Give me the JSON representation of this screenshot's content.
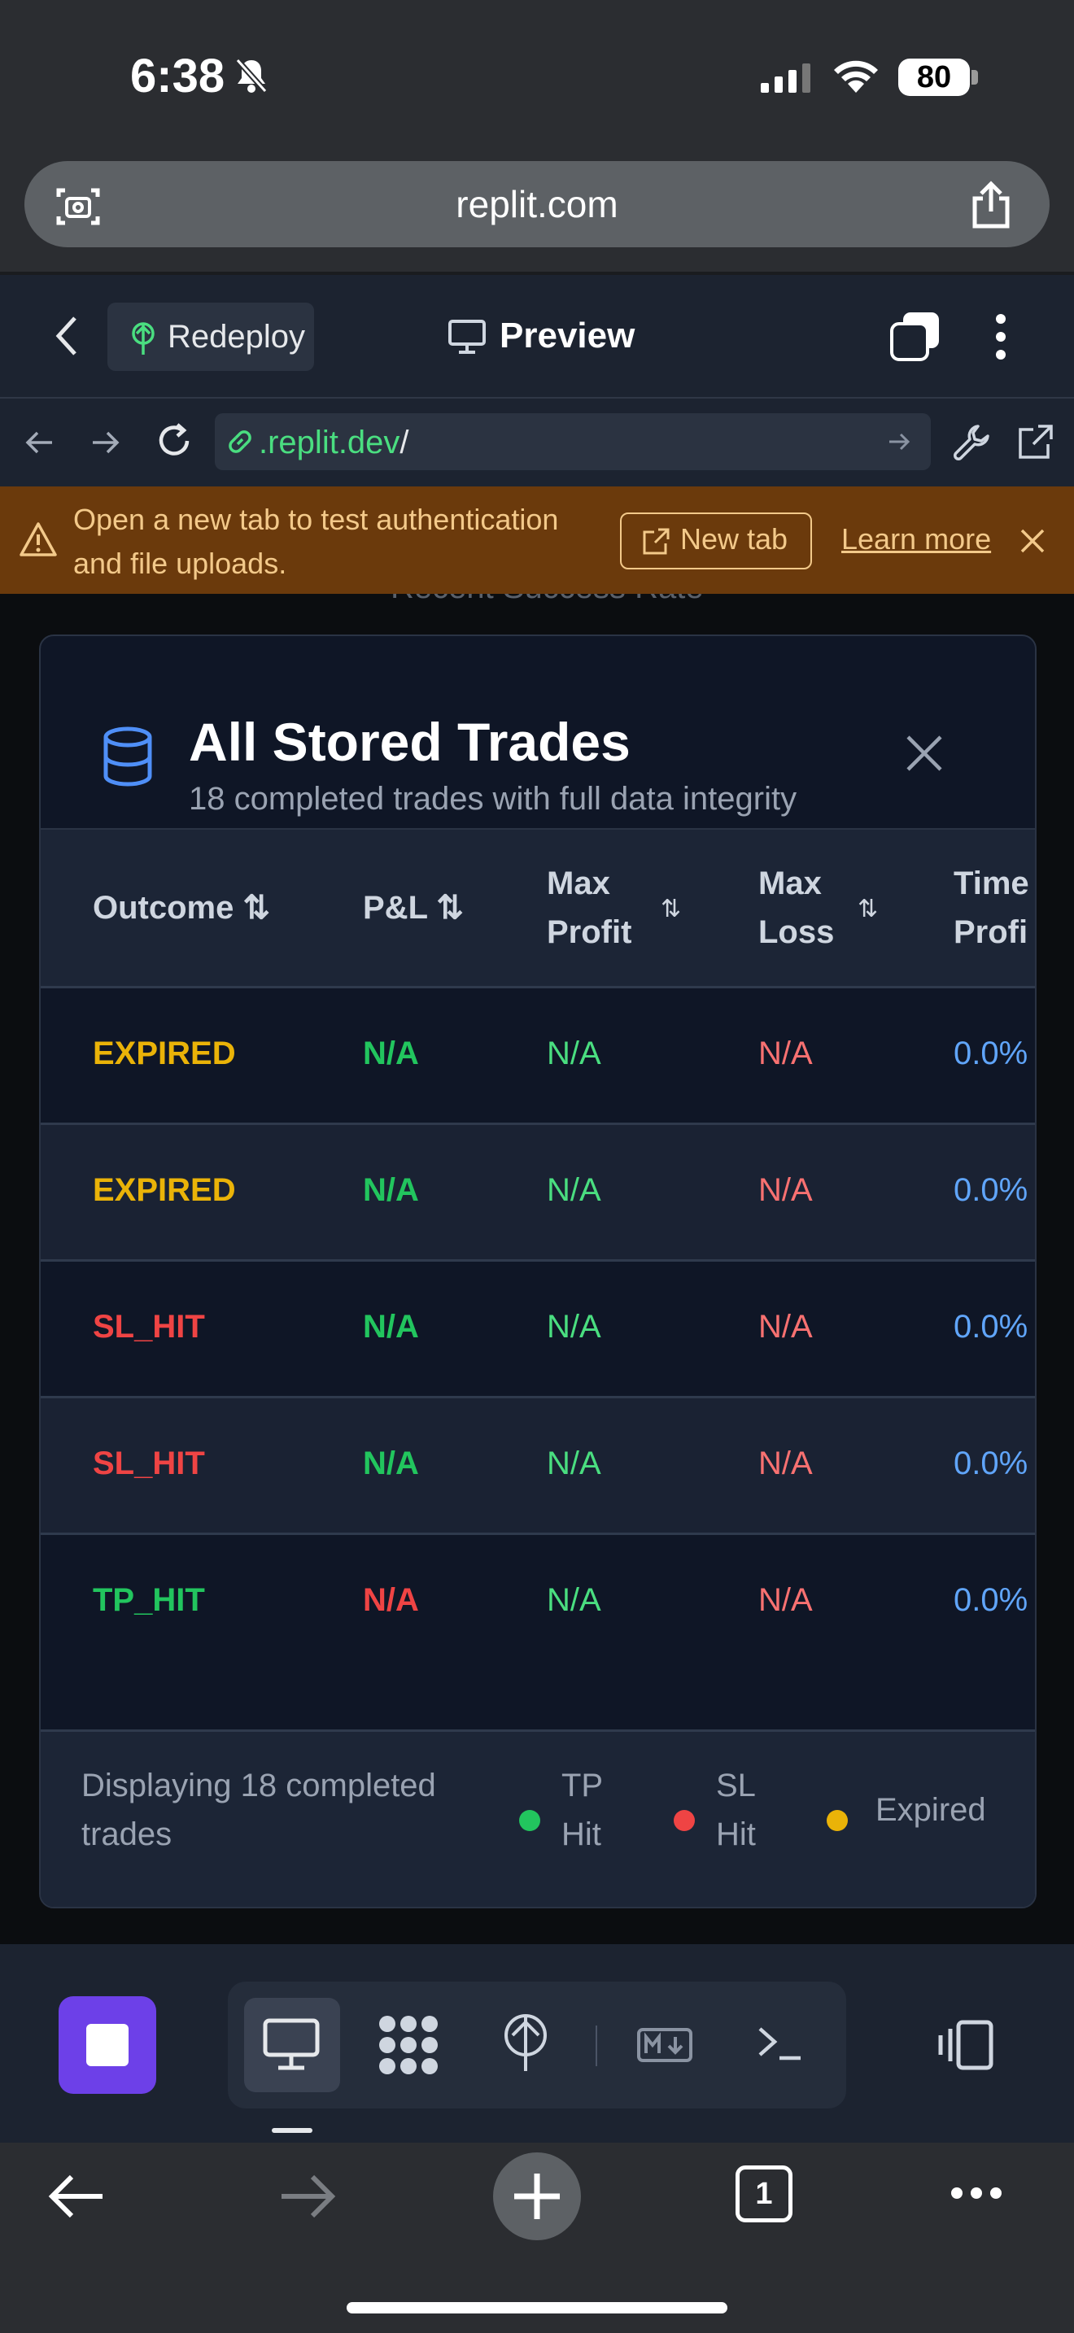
{
  "status_bar": {
    "time": "6:38",
    "battery": "80"
  },
  "browser": {
    "url": "replit.com"
  },
  "replit_header": {
    "redeploy_label": "Redeploy",
    "preview_label": "Preview"
  },
  "preview_nav": {
    "address_domain": ".replit.dev",
    "address_path": "/"
  },
  "banner": {
    "message": "Open a new tab to test authentication and file uploads.",
    "new_tab_label": "New tab",
    "learn_more_label": "Learn more"
  },
  "background_text": "Recent Success Rate",
  "modal": {
    "title": "All Stored Trades",
    "subtitle": "18 completed trades with full data integrity",
    "columns": [
      {
        "label": "Outcome"
      },
      {
        "label": "P&L"
      },
      {
        "label": "Max Profit"
      },
      {
        "label": "Max Loss"
      },
      {
        "label": "Time Profi"
      }
    ],
    "rows": [
      {
        "outcome": "EXPIRED",
        "pnl": "N/A",
        "max_profit": "N/A",
        "max_loss": "N/A",
        "time_profit": "0.0%"
      },
      {
        "outcome": "EXPIRED",
        "pnl": "N/A",
        "max_profit": "N/A",
        "max_loss": "N/A",
        "time_profit": "0.0%"
      },
      {
        "outcome": "SL_HIT",
        "pnl": "N/A",
        "max_profit": "N/A",
        "max_loss": "N/A",
        "time_profit": "0.0%"
      },
      {
        "outcome": "SL_HIT",
        "pnl": "N/A",
        "max_profit": "N/A",
        "max_loss": "N/A",
        "time_profit": "0.0%"
      },
      {
        "outcome": "TP_HIT",
        "pnl": "N/A",
        "max_profit": "N/A",
        "max_loss": "N/A",
        "time_profit": "0.0%"
      }
    ],
    "footer": {
      "display_text": "Displaying 18 completed trades",
      "legend": [
        {
          "label": "TP Hit",
          "color": "#22c55e"
        },
        {
          "label": "SL Hit",
          "color": "#ef4444"
        },
        {
          "label": "Expired",
          "color": "#eab308"
        }
      ]
    }
  },
  "safari_bar": {
    "tab_count": "1"
  },
  "colors": {
    "expired": "#eab308",
    "sl_hit": "#ef4444",
    "tp_hit": "#22c55e",
    "pnl_green": "#22c55e",
    "pnl_red": "#ef4444",
    "max_profit": "#4ade80",
    "max_loss": "#f87171",
    "time_profit": "#60a5fa",
    "accent_purple": "#6d40e8",
    "banner_bg": "#6b3a0c"
  }
}
